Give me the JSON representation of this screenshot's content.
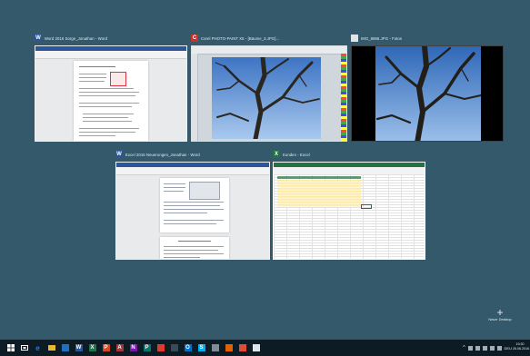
{
  "task_view": {
    "windows": [
      {
        "title": "Word 2016 Sorge_Jonathan - Word",
        "app": "Word",
        "app_letter": "W",
        "color": "#2b579a"
      },
      {
        "title": "Corel PHOTO-PAINT X5 - [Bäume_3.JPG]...",
        "app": "Corel",
        "app_letter": "C",
        "color": "#c8312b"
      },
      {
        "title": "IMG_8866.JPG - Fotos",
        "app": "Fotos",
        "app_letter": "",
        "color": "#dfe6ea"
      },
      {
        "title": "Excel 2016 Neuerungen_Jonathan - Word",
        "app": "Word",
        "app_letter": "W",
        "color": "#2b579a"
      },
      {
        "title": "Kunden - Excel",
        "app": "Excel",
        "app_letter": "X",
        "color": "#217346"
      }
    ],
    "new_desktop": {
      "icon": "plus-icon",
      "label": "Neuer Desktop"
    }
  },
  "taskbar": {
    "icons": [
      {
        "name": "start-icon",
        "letter": "",
        "color": "#ffffff"
      },
      {
        "name": "task-view-icon",
        "letter": "",
        "color": "#ffffff"
      },
      {
        "name": "edge-icon",
        "letter": "e",
        "color": "#2d7ad6"
      },
      {
        "name": "explorer-icon",
        "letter": "",
        "color": "#e8b830"
      },
      {
        "name": "store-icon",
        "letter": "",
        "color": "#1f6fc2"
      },
      {
        "name": "word-icon",
        "letter": "W",
        "color": "#2b579a"
      },
      {
        "name": "excel-icon",
        "letter": "X",
        "color": "#217346"
      },
      {
        "name": "powerpoint-icon",
        "letter": "P",
        "color": "#d24726"
      },
      {
        "name": "access-icon",
        "letter": "A",
        "color": "#a4373a"
      },
      {
        "name": "onenote-icon",
        "letter": "N",
        "color": "#7719aa"
      },
      {
        "name": "publisher-icon",
        "letter": "P",
        "color": "#077568"
      },
      {
        "name": "corel-icon",
        "letter": "",
        "color": "#e03a2e"
      },
      {
        "name": "calculator-icon",
        "letter": "",
        "color": "#3a4a56"
      },
      {
        "name": "outlook-icon",
        "letter": "O",
        "color": "#0072c6"
      },
      {
        "name": "skype-icon",
        "letter": "S",
        "color": "#00aff0"
      },
      {
        "name": "settings-icon",
        "letter": "",
        "color": "#7f8c96"
      },
      {
        "name": "firefox-icon",
        "letter": "",
        "color": "#e66000"
      },
      {
        "name": "paint-icon",
        "letter": "",
        "color": "#e04a3a"
      },
      {
        "name": "photos-icon",
        "letter": "",
        "color": "#dfe6ea"
      }
    ],
    "tray_lang": "DEU",
    "clock_time": "19:30",
    "clock_date": "26.06.2016"
  },
  "colors": {
    "desktop_bg": "#33596a",
    "taskbar_bg": "#0d1b24",
    "word_blue": "#2b579a",
    "excel_green": "#217346",
    "corel_red": "#c8312b"
  }
}
